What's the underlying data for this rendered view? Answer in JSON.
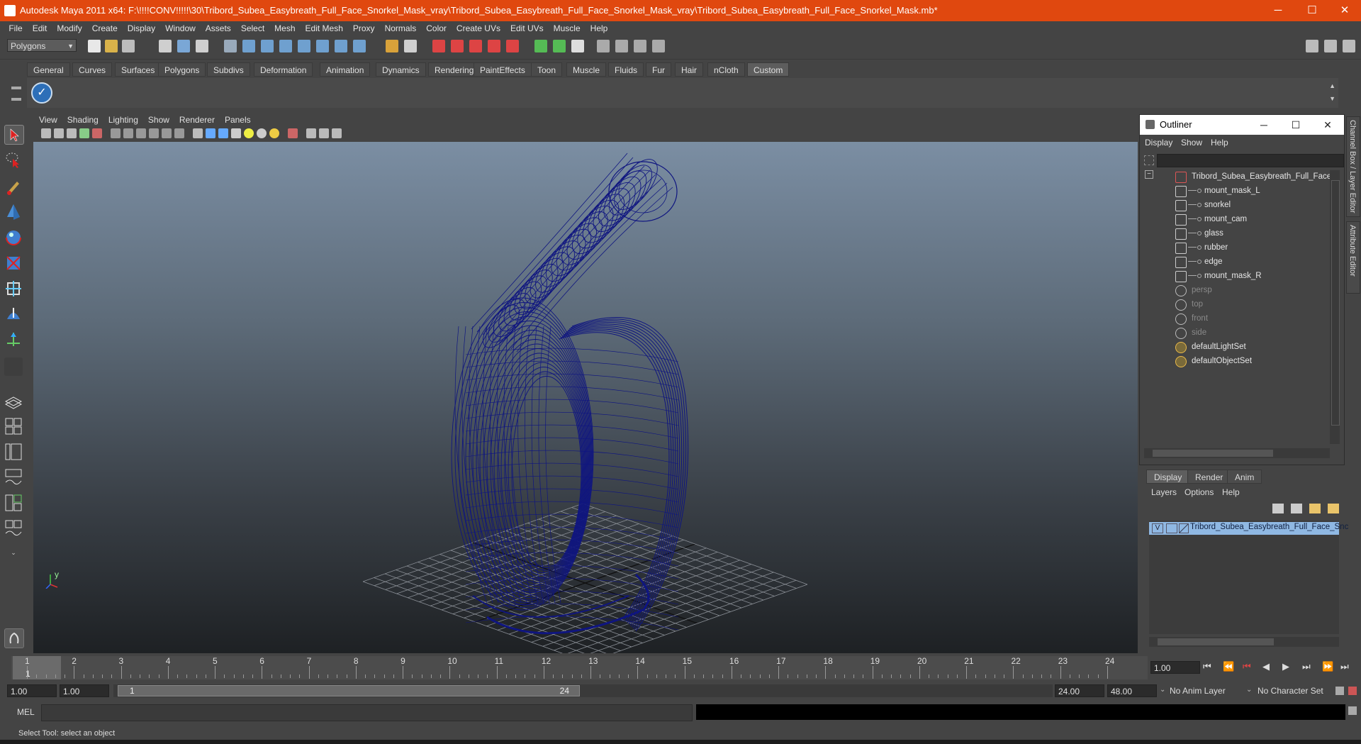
{
  "window": {
    "title": "Autodesk Maya 2011 x64: F:\\!!!!CONV!!!!!\\30\\Tribord_Subea_Easybreath_Full_Face_Snorkel_Mask_vray\\Tribord_Subea_Easybreath_Full_Face_Snorkel_Mask_vray\\Tribord_Subea_Easybreath_Full_Face_Snorkel_Mask.mb*",
    "minimize": "─",
    "maximize": "☐",
    "close": "✕"
  },
  "menubar": [
    "File",
    "Edit",
    "Modify",
    "Create",
    "Display",
    "Window",
    "Assets",
    "Select",
    "Mesh",
    "Edit Mesh",
    "Proxy",
    "Normals",
    "Color",
    "Create UVs",
    "Edit UVs",
    "Muscle",
    "Help"
  ],
  "statusline": {
    "mode": "Polygons"
  },
  "shelf": {
    "tabs": [
      "General",
      "Curves",
      "Surfaces",
      "Polygons",
      "Subdivs",
      "Deformation",
      "Animation",
      "Dynamics",
      "Rendering",
      "PaintEffects",
      "Toon",
      "Muscle",
      "Fluids",
      "Fur",
      "Hair",
      "nCloth",
      "Custom"
    ],
    "active": "Custom"
  },
  "viewport": {
    "menu": [
      "View",
      "Shading",
      "Lighting",
      "Show",
      "Renderer",
      "Panels"
    ],
    "axis_label": "y",
    "wire_color": "#0f1580",
    "background_top": "#7b8ea3",
    "background_bottom": "#1e2124"
  },
  "outliner": {
    "title": "Outliner",
    "menu": [
      "Display",
      "Show",
      "Help"
    ],
    "items": [
      {
        "label": "Tribord_Subea_Easybreath_Full_Face_S",
        "indent": 0,
        "dim": false,
        "icon": "group-icon"
      },
      {
        "label": "mount_mask_L",
        "indent": 1,
        "dim": false,
        "icon": "mesh-icon"
      },
      {
        "label": "snorkel",
        "indent": 1,
        "dim": false,
        "icon": "mesh-icon"
      },
      {
        "label": "mount_cam",
        "indent": 1,
        "dim": false,
        "icon": "mesh-icon"
      },
      {
        "label": "glass",
        "indent": 1,
        "dim": false,
        "icon": "mesh-icon"
      },
      {
        "label": "rubber",
        "indent": 1,
        "dim": false,
        "icon": "mesh-icon"
      },
      {
        "label": "edge",
        "indent": 1,
        "dim": false,
        "icon": "mesh-icon"
      },
      {
        "label": "mount_mask_R",
        "indent": 1,
        "dim": false,
        "icon": "mesh-icon"
      },
      {
        "label": "persp",
        "indent": 0,
        "dim": true,
        "icon": "camera-icon"
      },
      {
        "label": "top",
        "indent": 0,
        "dim": true,
        "icon": "camera-icon"
      },
      {
        "label": "front",
        "indent": 0,
        "dim": true,
        "icon": "camera-icon"
      },
      {
        "label": "side",
        "indent": 0,
        "dim": true,
        "icon": "camera-icon"
      },
      {
        "label": "defaultLightSet",
        "indent": 0,
        "dim": false,
        "icon": "set-icon"
      },
      {
        "label": "defaultObjectSet",
        "indent": 0,
        "dim": false,
        "icon": "set-icon"
      }
    ]
  },
  "side_tabs": {
    "channel_box": "Channel Box / Layer Editor",
    "attribute_editor": "Attribute Editor"
  },
  "layer_editor": {
    "tabs": [
      "Display",
      "Render",
      "Anim"
    ],
    "active": "Display",
    "menu": [
      "Layers",
      "Options",
      "Help"
    ],
    "layers": [
      {
        "visible": "V",
        "name": "Tribord_Subea_Easybreath_Full_Face_Snc"
      }
    ]
  },
  "timeslider": {
    "ticks": [
      "1",
      "2",
      "3",
      "4",
      "5",
      "6",
      "7",
      "8",
      "9",
      "10",
      "11",
      "12",
      "13",
      "14",
      "15",
      "16",
      "17",
      "18",
      "19",
      "20",
      "21",
      "22",
      "23",
      "24"
    ],
    "current_frame": "1",
    "current_time_field": "1.00"
  },
  "range": {
    "start_field": "1.00",
    "playback_start": "1.00",
    "slider_start": "1",
    "slider_end": "24",
    "playback_end": "24.00",
    "end_field": "48.00",
    "anim_layer": "No Anim Layer",
    "character_set": "No Character Set"
  },
  "command_line": {
    "label": "MEL"
  },
  "help_line": "Select Tool: select an object"
}
